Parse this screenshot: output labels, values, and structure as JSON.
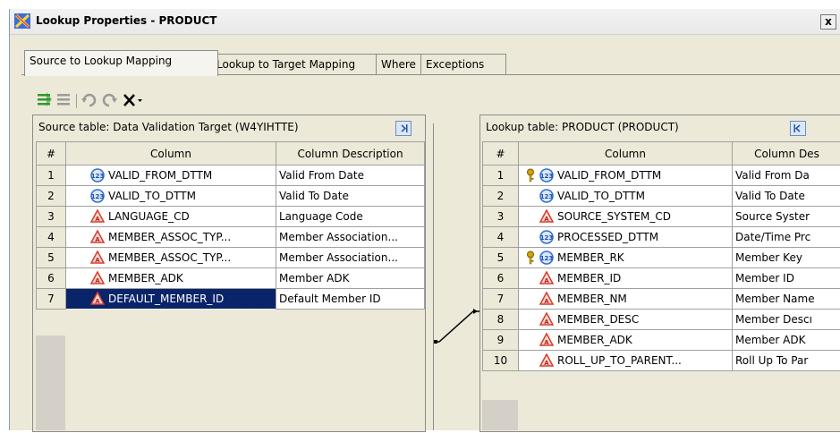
{
  "window": {
    "title": "Lookup Properties - PRODUCT",
    "close_label": "x"
  },
  "tabs": [
    {
      "label": "Source to Lookup Mapping"
    },
    {
      "label": "Lookup to Target Mapping"
    },
    {
      "label": "Where"
    },
    {
      "label": "Exceptions"
    }
  ],
  "toolbar": {
    "items": [
      "map-all-icon",
      "unmap-icon",
      "undo-icon",
      "redo-icon",
      "delete-dropdown-icon"
    ]
  },
  "source": {
    "header": "Source table: Data Validation Target (W4YIHTTE)",
    "columns": [
      "#",
      "Column",
      "Column Description"
    ],
    "rows": [
      {
        "num": "1",
        "icon": "numeric",
        "column": "VALID_FROM_DTTM",
        "desc": "Valid From Date"
      },
      {
        "num": "2",
        "icon": "numeric",
        "column": "VALID_TO_DTTM",
        "desc": "Valid To Date"
      },
      {
        "num": "3",
        "icon": "character",
        "column": "LANGUAGE_CD",
        "desc": "Language Code"
      },
      {
        "num": "4",
        "icon": "character",
        "column": "MEMBER_ASSOC_TYP...",
        "desc": "Member Association..."
      },
      {
        "num": "5",
        "icon": "character",
        "column": "MEMBER_ASSOC_TYP...",
        "desc": "Member Association..."
      },
      {
        "num": "6",
        "icon": "character",
        "column": "MEMBER_ADK",
        "desc": "Member ADK"
      },
      {
        "num": "7",
        "icon": "character",
        "column": "DEFAULT_MEMBER_ID",
        "desc": "Default Member ID"
      }
    ]
  },
  "lookup": {
    "header": "Lookup table: PRODUCT (PRODUCT)",
    "columns": [
      "#",
      "Column",
      "Column Des"
    ],
    "rows": [
      {
        "num": "1",
        "key": true,
        "icon": "numeric",
        "column": "VALID_FROM_DTTM",
        "desc": "Valid From Da"
      },
      {
        "num": "2",
        "key": false,
        "icon": "numeric",
        "column": "VALID_TO_DTTM",
        "desc": "Valid To Date"
      },
      {
        "num": "3",
        "key": false,
        "icon": "character",
        "column": "SOURCE_SYSTEM_CD",
        "desc": "Source Syster"
      },
      {
        "num": "4",
        "key": false,
        "icon": "numeric",
        "column": "PROCESSED_DTTM",
        "desc": "Date/Time Prc"
      },
      {
        "num": "5",
        "key": true,
        "icon": "numeric",
        "column": "MEMBER_RK",
        "desc": "Member Key"
      },
      {
        "num": "6",
        "key": false,
        "icon": "character",
        "column": "MEMBER_ID",
        "desc": "Member ID"
      },
      {
        "num": "7",
        "key": false,
        "icon": "character",
        "column": "MEMBER_NM",
        "desc": "Member Name"
      },
      {
        "num": "8",
        "key": false,
        "icon": "character",
        "column": "MEMBER_DESC",
        "desc": "Member Descı"
      },
      {
        "num": "9",
        "key": false,
        "icon": "character",
        "column": "MEMBER_ADK",
        "desc": "Member ADK"
      },
      {
        "num": "10",
        "key": false,
        "icon": "character",
        "column": "ROLL_UP_TO_PARENT...",
        "desc": "Roll Up To Par"
      }
    ]
  },
  "mapping": {
    "from_row": "7",
    "to_row": "6"
  },
  "colors": {
    "selection": "#0a246a",
    "numeric_icon": "#2f6fd6",
    "character_icon": "#d93a2b",
    "key_icon": "#d6a400"
  }
}
